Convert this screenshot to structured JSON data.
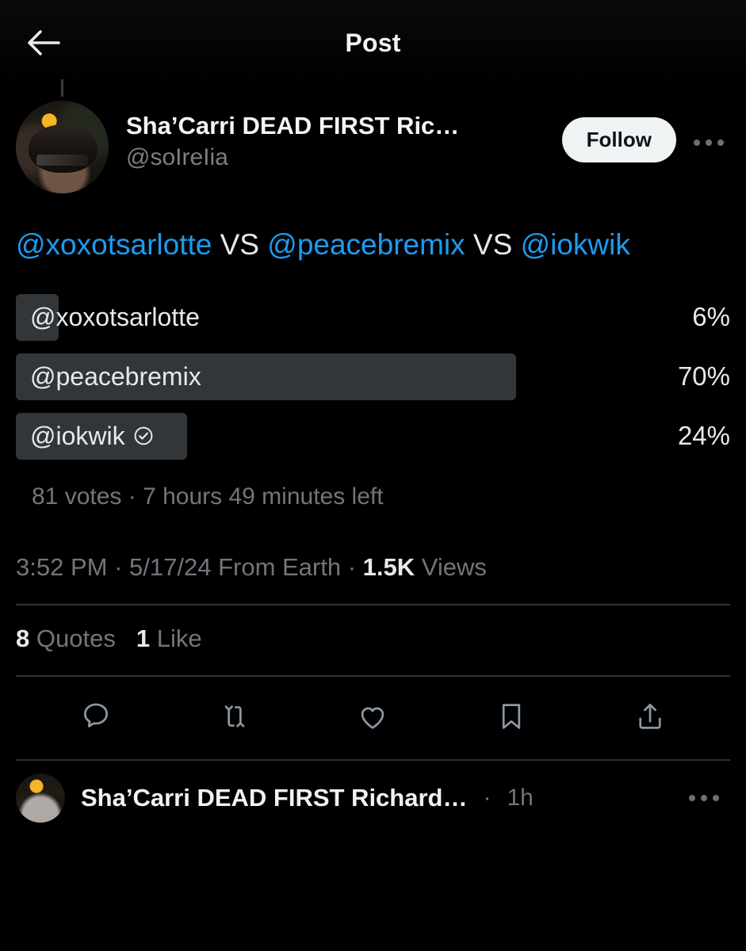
{
  "header": {
    "title": "Post",
    "back_icon": "back-arrow-icon"
  },
  "post": {
    "author": {
      "display_name": "Sha’Carri DEAD FIRST Ric…",
      "handle": "@soIreIia",
      "avatar": "profile-photo",
      "follow_label": "Follow",
      "more_icon": "more-options-icon"
    },
    "text_segments": [
      {
        "text": "@xoxotsarlotte",
        "type": "mention"
      },
      {
        "text": " VS ",
        "type": "plain"
      },
      {
        "text": "@peacebremix",
        "type": "mention"
      },
      {
        "text": " VS ",
        "type": "plain"
      },
      {
        "text": "@iokwik",
        "type": "mention"
      }
    ],
    "poll": {
      "options": [
        {
          "label": "@xoxotsarlotte",
          "percent": "6%",
          "value": 6,
          "voted": false
        },
        {
          "label": "@peacebremix",
          "percent": "70%",
          "value": 70,
          "voted": false
        },
        {
          "label": "@iokwik",
          "percent": "24%",
          "value": 24,
          "voted": true
        }
      ],
      "meta": "81 votes · 7 hours 49 minutes left",
      "votes": "81 votes",
      "time_left": "7 hours 49 minutes left",
      "bar_color": "#333639"
    },
    "timestamp": {
      "time": "3:52 PM",
      "separator_1": " · ",
      "date": "5/17/24",
      "source": " From Earth",
      "separator_2": " · ",
      "views_count": "1.5K",
      "views_label": " Views"
    },
    "stats": [
      {
        "count": "8",
        "label": "Quotes"
      },
      {
        "count": "1",
        "label": "Like"
      }
    ],
    "actions": [
      {
        "name": "reply-icon",
        "label": "Reply"
      },
      {
        "name": "retweet-icon",
        "label": "Repost"
      },
      {
        "name": "like-icon",
        "label": "Like"
      },
      {
        "name": "bookmark-icon",
        "label": "Bookmark"
      },
      {
        "name": "share-icon",
        "label": "Share"
      }
    ]
  },
  "reply_preview": {
    "display_name": "Sha’Carri DEAD FIRST Richard…",
    "dot": "·",
    "time": "1h",
    "more_icon": "more-options-icon"
  },
  "colors": {
    "background": "#000000",
    "link": "#1d9bf0",
    "text_primary": "#e7e9ea",
    "text_secondary": "#71767b",
    "divider": "#2f3336",
    "follow_bg": "#eff3f4"
  }
}
